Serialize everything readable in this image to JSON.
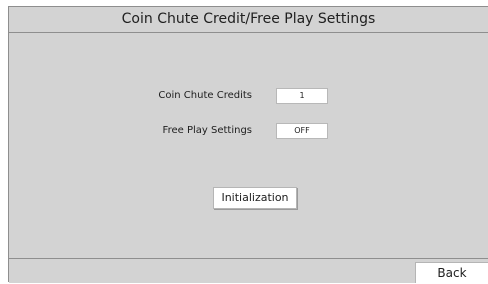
{
  "header": {
    "title": "Coin Chute Credit/Free Play Settings"
  },
  "settings": [
    {
      "label": "Coin Chute Credits",
      "value": "1"
    },
    {
      "label": "Free Play Settings",
      "value": "OFF"
    }
  ],
  "actions": {
    "initialization_label": "Initialization",
    "back_label": "Back"
  }
}
